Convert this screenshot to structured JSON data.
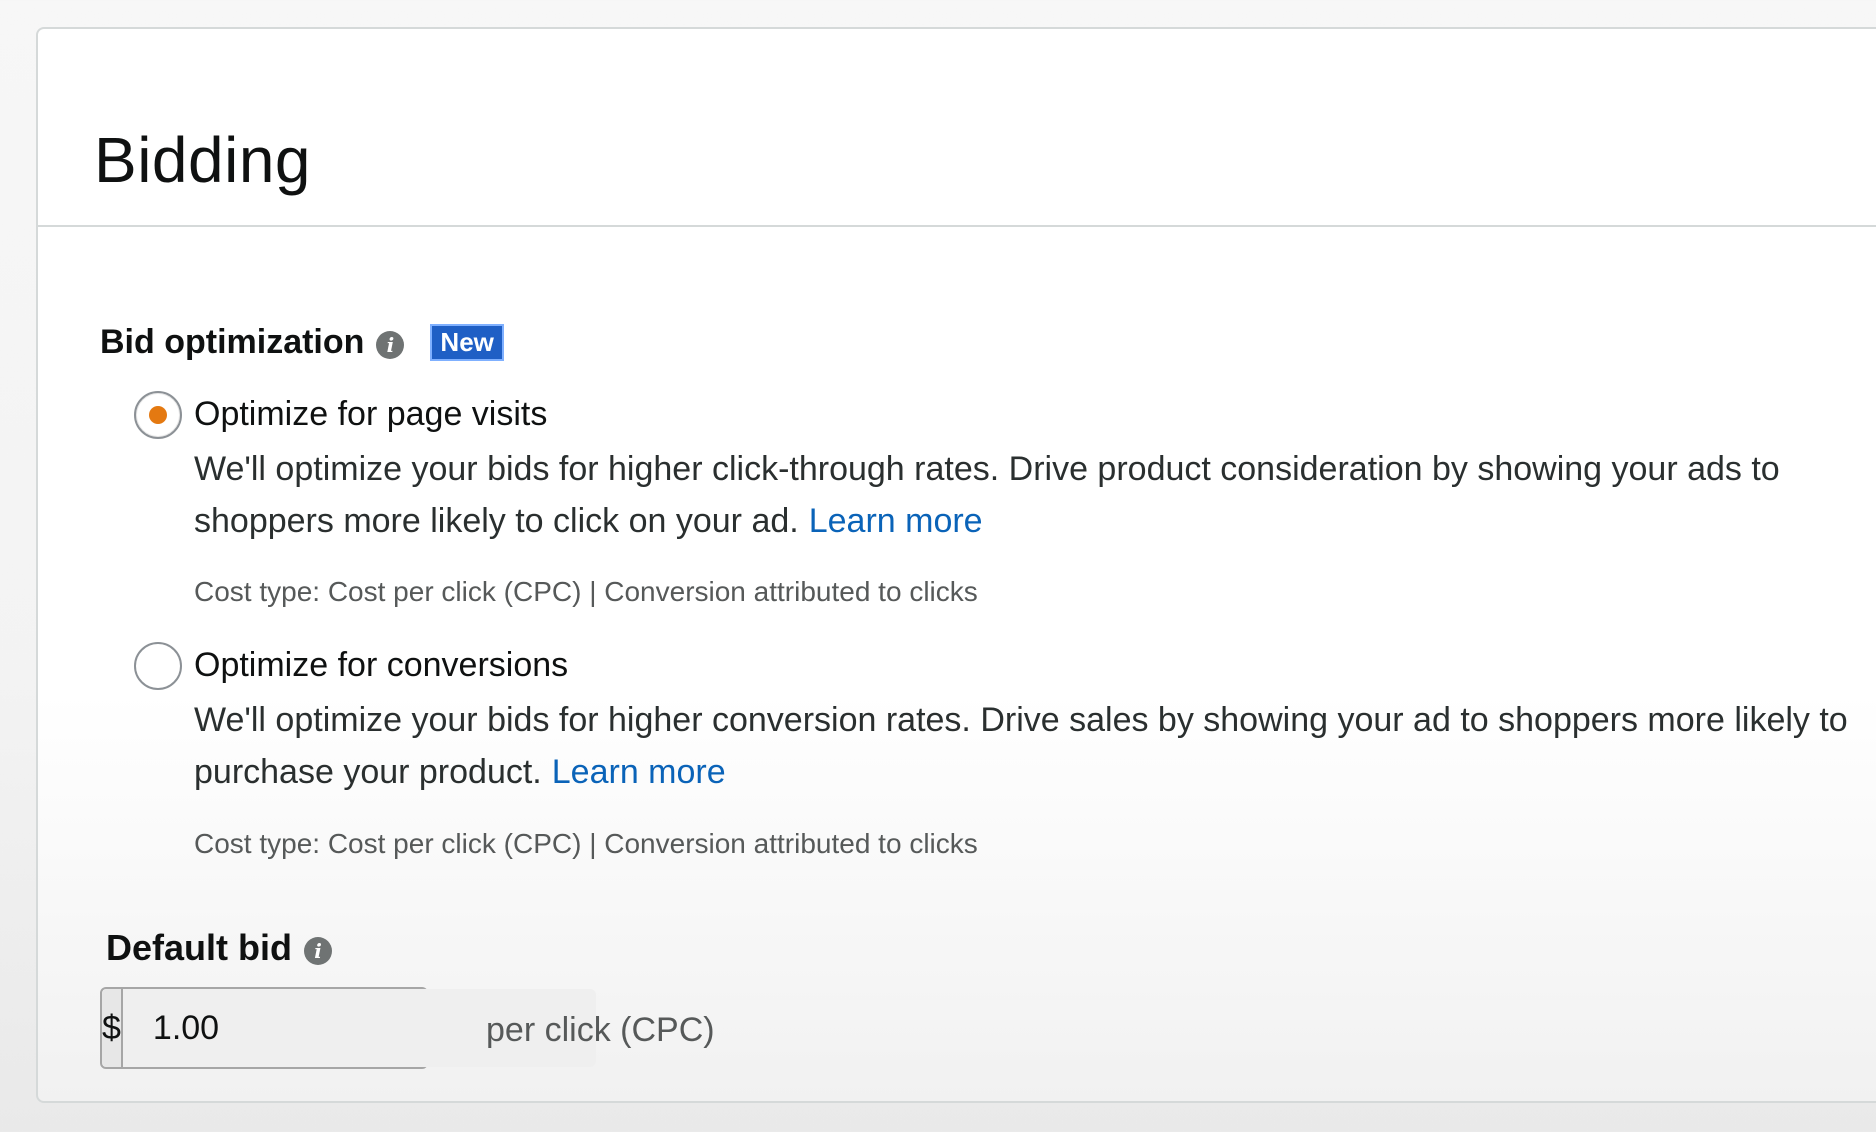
{
  "panel": {
    "title": "Bidding"
  },
  "bid_optimization": {
    "label": "Bid optimization",
    "info_icon": "info-icon",
    "badge": "New",
    "options": [
      {
        "title": "Optimize for page visits",
        "description": "We'll optimize your bids for higher click-through rates. Drive product consideration by showing your ads to shoppers more likely to click on your ad.",
        "learn_more": "Learn more",
        "meta": "Cost type: Cost per click (CPC) | Conversion attributed to clicks",
        "selected": true
      },
      {
        "title": "Optimize for conversions",
        "description": "We'll optimize your bids for higher conversion rates. Drive sales by showing your ad to shoppers more likely to purchase your product.",
        "learn_more": "Learn more",
        "meta": "Cost type: Cost per click (CPC) | Conversion attributed to clicks",
        "selected": false
      }
    ]
  },
  "default_bid": {
    "label": "Default bid",
    "info_icon": "info-icon",
    "currency": "$",
    "value": "1.00",
    "unit": "per click (CPC)"
  },
  "colors": {
    "accent_radio": "#e47911",
    "link": "#0a63b8",
    "badge_bg": "#1f5fc5"
  }
}
